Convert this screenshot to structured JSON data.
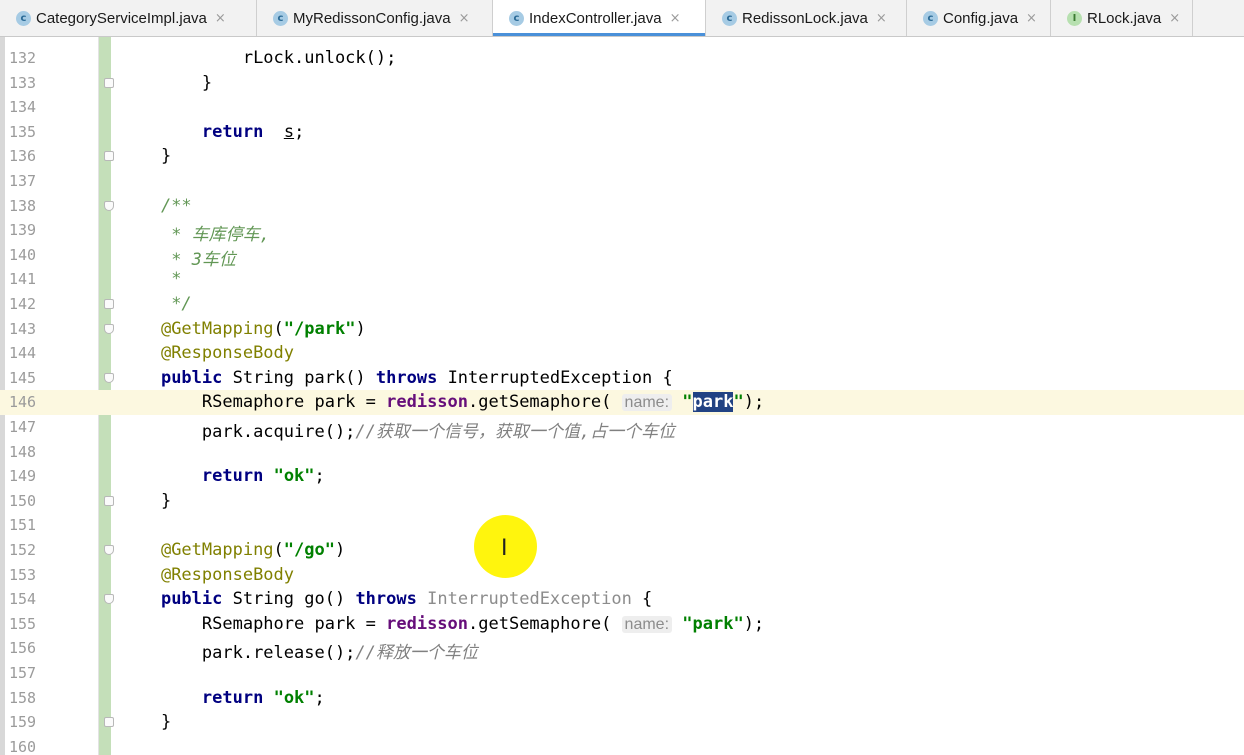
{
  "tabs": [
    {
      "name": "CategoryServiceImpl.java",
      "icon": "class",
      "active": false
    },
    {
      "name": "MyRedissonConfig.java",
      "icon": "class",
      "active": false
    },
    {
      "name": "IndexController.java",
      "icon": "class",
      "active": true
    },
    {
      "name": "RedissonLock.java",
      "icon": "class",
      "active": false
    },
    {
      "name": "Config.java",
      "icon": "class",
      "active": false
    },
    {
      "name": "RLock.java",
      "icon": "interface",
      "active": false
    }
  ],
  "tab_close_glyph": "×",
  "tab_icon_letters": {
    "class": "c",
    "interface": "I"
  },
  "current_line": "146",
  "lines": [
    {
      "n": "132",
      "fold": "",
      "tokens": [
        [
          "",
          "        rLock.unlock();"
        ]
      ]
    },
    {
      "n": "133",
      "fold": "up",
      "tokens": [
        [
          "",
          "    }"
        ]
      ]
    },
    {
      "n": "134",
      "fold": "",
      "tokens": []
    },
    {
      "n": "135",
      "fold": "",
      "tokens": [
        [
          "",
          "    "
        ],
        [
          "kw",
          "return"
        ],
        [
          "",
          "  "
        ],
        [
          "uline",
          "s"
        ],
        [
          "",
          ";"
        ]
      ]
    },
    {
      "n": "136",
      "fold": "up",
      "tokens": [
        [
          "",
          "}"
        ]
      ]
    },
    {
      "n": "137",
      "fold": "",
      "tokens": []
    },
    {
      "n": "138",
      "fold": "down",
      "tokens": [
        [
          "doc",
          "/**"
        ]
      ]
    },
    {
      "n": "139",
      "fold": "",
      "tokens": [
        [
          "doc",
          " * 车库停车,"
        ]
      ]
    },
    {
      "n": "140",
      "fold": "",
      "tokens": [
        [
          "doc",
          " * 3车位"
        ]
      ]
    },
    {
      "n": "141",
      "fold": "",
      "tokens": [
        [
          "doc",
          " *"
        ]
      ]
    },
    {
      "n": "142",
      "fold": "up",
      "tokens": [
        [
          "doc",
          " */"
        ]
      ]
    },
    {
      "n": "143",
      "fold": "down",
      "tokens": [
        [
          "ann",
          "@GetMapping"
        ],
        [
          "",
          "("
        ],
        [
          "str",
          "\"/park\""
        ],
        [
          "",
          ")"
        ]
      ]
    },
    {
      "n": "144",
      "fold": "",
      "tokens": [
        [
          "ann",
          "@ResponseBody"
        ]
      ]
    },
    {
      "n": "145",
      "fold": "down",
      "tokens": [
        [
          "kw",
          "public"
        ],
        [
          "",
          " String park() "
        ],
        [
          "kw",
          "throws"
        ],
        [
          "",
          " InterruptedException {"
        ]
      ]
    },
    {
      "n": "146",
      "fold": "",
      "tokens": [
        [
          "",
          "    RSemaphore park = "
        ],
        [
          "fld",
          "redisson"
        ],
        [
          "",
          ".getSemaphore( "
        ],
        [
          "hint",
          "name:"
        ],
        [
          "",
          " "
        ],
        [
          "str",
          "\""
        ],
        [
          "sel",
          "park"
        ],
        [
          "str",
          "\""
        ],
        [
          "",
          ");"
        ]
      ]
    },
    {
      "n": "147",
      "fold": "",
      "tokens": [
        [
          "",
          "    park.acquire();"
        ],
        [
          "cmt",
          "//获取一个信号，获取一个值,占一个车位"
        ]
      ]
    },
    {
      "n": "148",
      "fold": "",
      "tokens": []
    },
    {
      "n": "149",
      "fold": "",
      "tokens": [
        [
          "",
          "    "
        ],
        [
          "kw",
          "return"
        ],
        [
          "",
          " "
        ],
        [
          "str",
          "\"ok\""
        ],
        [
          "",
          ";"
        ]
      ]
    },
    {
      "n": "150",
      "fold": "up",
      "tokens": [
        [
          "",
          "}"
        ]
      ]
    },
    {
      "n": "151",
      "fold": "",
      "tokens": []
    },
    {
      "n": "152",
      "fold": "down",
      "tokens": [
        [
          "ann",
          "@GetMapping"
        ],
        [
          "",
          "("
        ],
        [
          "str",
          "\"/go\""
        ],
        [
          "",
          ")"
        ]
      ]
    },
    {
      "n": "153",
      "fold": "",
      "tokens": [
        [
          "ann",
          "@ResponseBody"
        ]
      ]
    },
    {
      "n": "154",
      "fold": "down",
      "tokens": [
        [
          "kw",
          "public"
        ],
        [
          "",
          " String go() "
        ],
        [
          "kw",
          "throws"
        ],
        [
          "",
          " "
        ],
        [
          "gray",
          "InterruptedException"
        ],
        [
          "",
          " {"
        ]
      ]
    },
    {
      "n": "155",
      "fold": "",
      "tokens": [
        [
          "",
          "    RSemaphore park = "
        ],
        [
          "fld",
          "redisson"
        ],
        [
          "",
          ".getSemaphore( "
        ],
        [
          "hint",
          "name:"
        ],
        [
          "",
          " "
        ],
        [
          "str",
          "\"park\""
        ],
        [
          "",
          ");"
        ]
      ]
    },
    {
      "n": "156",
      "fold": "",
      "tokens": [
        [
          "",
          "    park.release();"
        ],
        [
          "cmt",
          "//释放一个车位"
        ]
      ]
    },
    {
      "n": "157",
      "fold": "",
      "tokens": []
    },
    {
      "n": "158",
      "fold": "",
      "tokens": [
        [
          "",
          "    "
        ],
        [
          "kw",
          "return"
        ],
        [
          "",
          " "
        ],
        [
          "str",
          "\"ok\""
        ],
        [
          "",
          ";"
        ]
      ]
    },
    {
      "n": "159",
      "fold": "up",
      "tokens": [
        [
          "",
          "}"
        ]
      ]
    },
    {
      "n": "160",
      "fold": "",
      "tokens": []
    }
  ]
}
